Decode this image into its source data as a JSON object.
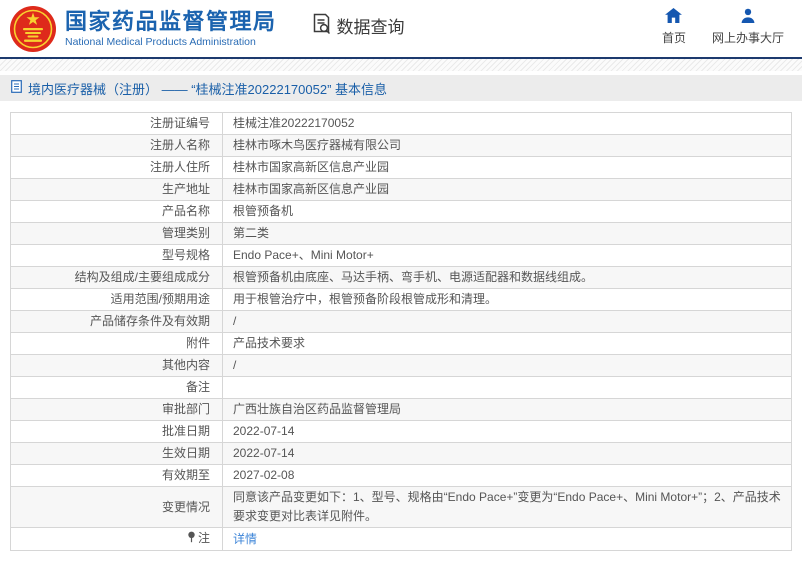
{
  "header": {
    "org_name_cn": "国家药品监督管理局",
    "org_name_en": "National Medical Products Administration",
    "section_title": "数据查询",
    "nav": [
      {
        "icon": "home-icon",
        "label": "首页"
      },
      {
        "icon": "person-icon",
        "label": "网上办事大厅"
      }
    ]
  },
  "breadcrumb": {
    "text": "境内医疗器械（注册） —— “桂械注准20222170052” 基本信息"
  },
  "table": {
    "rows": [
      {
        "label": "注册证编号",
        "value": "桂械注准20222170052"
      },
      {
        "label": "注册人名称",
        "value": "桂林市啄木鸟医疗器械有限公司"
      },
      {
        "label": "注册人住所",
        "value": "桂林市国家高新区信息产业园"
      },
      {
        "label": "生产地址",
        "value": "桂林市国家高新区信息产业园"
      },
      {
        "label": "产品名称",
        "value": "根管预备机"
      },
      {
        "label": "管理类别",
        "value": "第二类"
      },
      {
        "label": "型号规格",
        "value": "Endo Pace+、Mini Motor+"
      },
      {
        "label": "结构及组成/主要组成成分",
        "value": "根管预备机由底座、马达手柄、弯手机、电源适配器和数据线组成。"
      },
      {
        "label": "适用范围/预期用途",
        "value": "用于根管治疗中，根管预备阶段根管成形和清理。"
      },
      {
        "label": "产品储存条件及有效期",
        "value": "/"
      },
      {
        "label": "附件",
        "value": "产品技术要求"
      },
      {
        "label": "其他内容",
        "value": "/"
      },
      {
        "label": "备注",
        "value": ""
      },
      {
        "label": "审批部门",
        "value": "广西壮族自治区药品监督管理局"
      },
      {
        "label": "批准日期",
        "value": "2022-07-14"
      },
      {
        "label": "生效日期",
        "value": "2022-07-14"
      },
      {
        "label": "有效期至",
        "value": "2027-02-08"
      },
      {
        "label": "变更情况",
        "value": "同意该产品变更如下：1、型号、规格由“Endo Pace+”变更为“Endo Pace+、Mini Motor+”；2、产品技术要求变更对比表详见附件。"
      },
      {
        "label": "注",
        "label_icon": "pin-icon",
        "value": "详情",
        "link": true
      }
    ]
  },
  "colors": {
    "brand_blue": "#1b63af",
    "icon_blue": "#1557b0",
    "navy_line": "#1d3a6e",
    "breadcrumb_blue": "#1a5fa8",
    "link_blue": "#3d85d8",
    "emblem_red": "#de2a1b",
    "emblem_gold": "#f8d12f",
    "row_alt_bg": "#f7f7f7"
  }
}
